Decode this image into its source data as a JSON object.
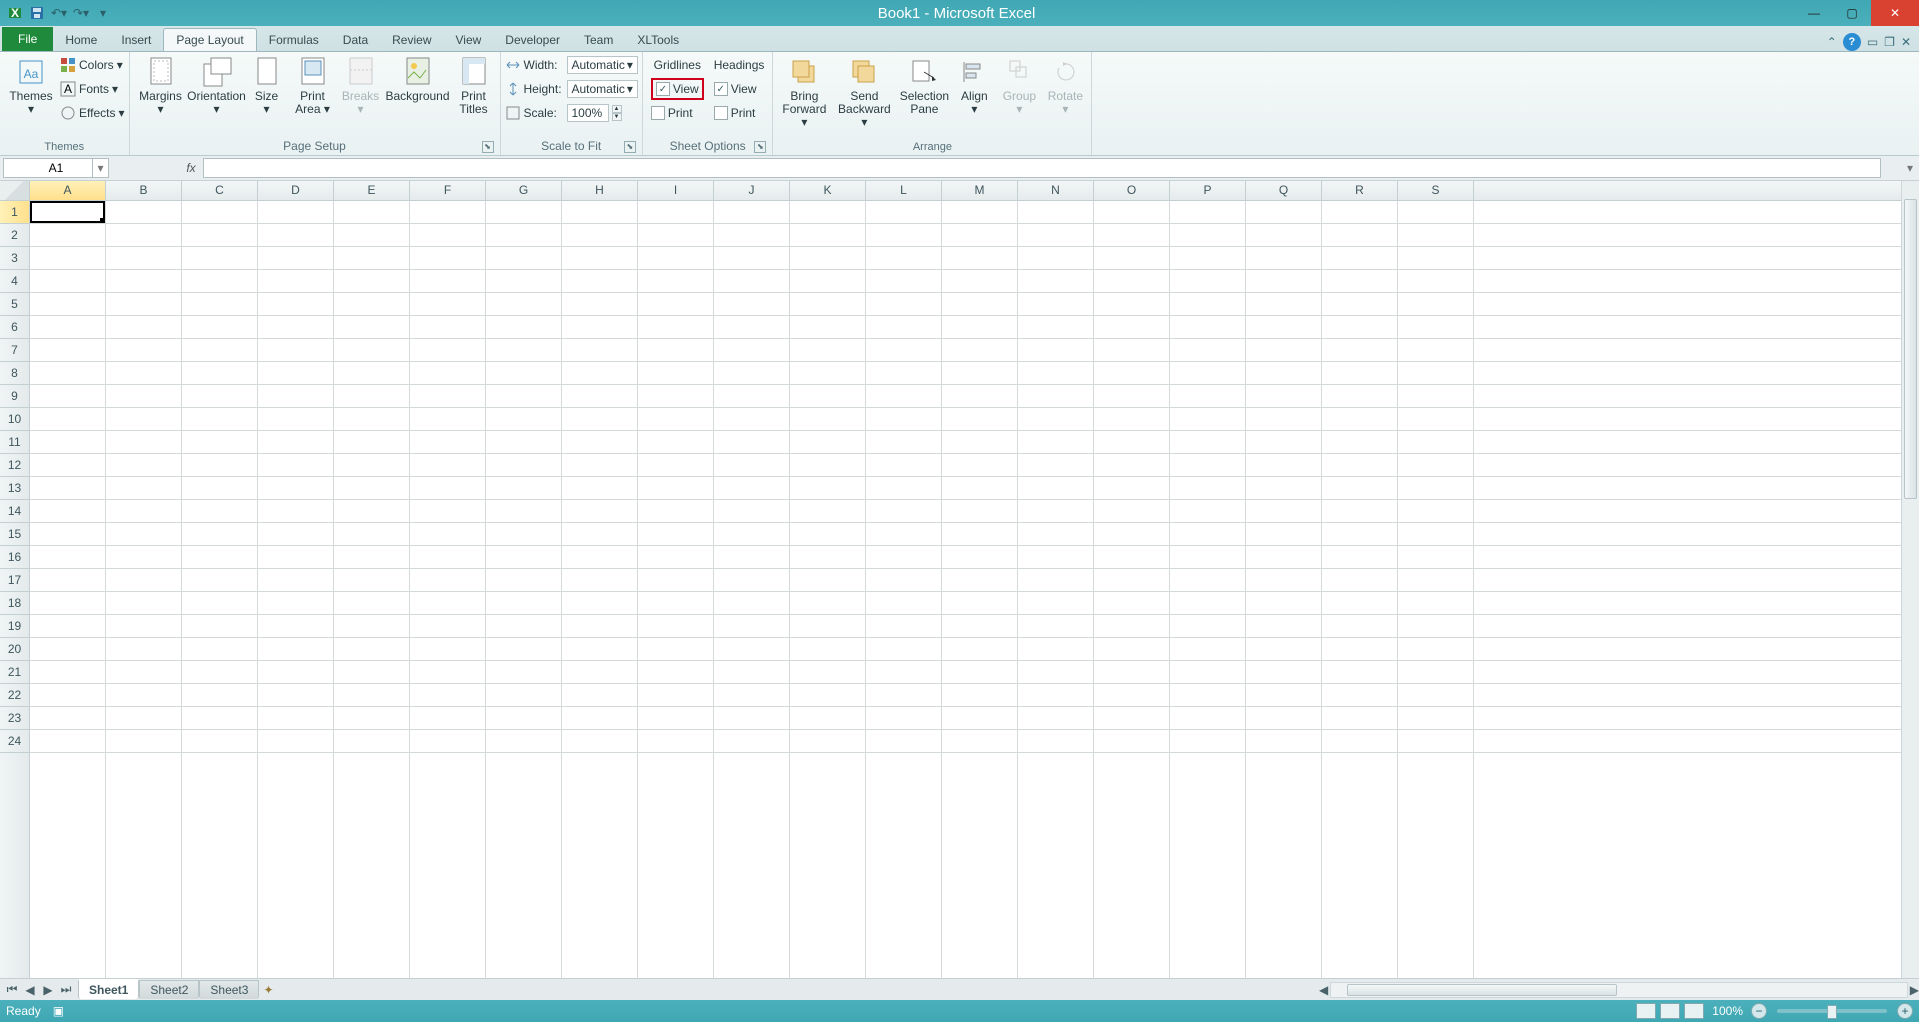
{
  "title": "Book1 - Microsoft Excel",
  "tabs": [
    "File",
    "Home",
    "Insert",
    "Page Layout",
    "Formulas",
    "Data",
    "Review",
    "View",
    "Developer",
    "Team",
    "XLTools"
  ],
  "active_tab": "Page Layout",
  "ribbon": {
    "themes": {
      "label": "Themes",
      "themes": "Themes",
      "colors": "Colors",
      "fonts": "Fonts",
      "effects": "Effects"
    },
    "page_setup": {
      "label": "Page Setup",
      "margins": "Margins",
      "orientation": "Orientation",
      "size": "Size",
      "print_area": "Print\nArea",
      "breaks": "Breaks",
      "background": "Background",
      "print_titles": "Print\nTitles"
    },
    "scale": {
      "label": "Scale to Fit",
      "width": "Width:",
      "height": "Height:",
      "scale": "Scale:",
      "width_val": "Automatic",
      "height_val": "Automatic",
      "scale_val": "100%"
    },
    "sheet_options": {
      "label": "Sheet Options",
      "gridlines": "Gridlines",
      "headings": "Headings",
      "view": "View",
      "print": "Print",
      "gridlines_view_checked": true,
      "gridlines_print_checked": false,
      "headings_view_checked": true,
      "headings_print_checked": false
    },
    "arrange": {
      "label": "Arrange",
      "bring_forward": "Bring\nForward",
      "send_backward": "Send\nBackward",
      "selection_pane": "Selection\nPane",
      "align": "Align",
      "group": "Group",
      "rotate": "Rotate"
    }
  },
  "namebox": "A1",
  "columns": [
    "A",
    "B",
    "C",
    "D",
    "E",
    "F",
    "G",
    "H",
    "I",
    "J",
    "K",
    "L",
    "M",
    "N",
    "O",
    "P",
    "Q",
    "R",
    "S"
  ],
  "rows": [
    1,
    2,
    3,
    4,
    5,
    6,
    7,
    8,
    9,
    10,
    11,
    12,
    13,
    14,
    15,
    16,
    17,
    18,
    19,
    20,
    21,
    22,
    23,
    24
  ],
  "active_col": "A",
  "active_row": 1,
  "sheets": [
    "Sheet1",
    "Sheet2",
    "Sheet3"
  ],
  "active_sheet": "Sheet1",
  "status": "Ready",
  "zoom": "100%"
}
